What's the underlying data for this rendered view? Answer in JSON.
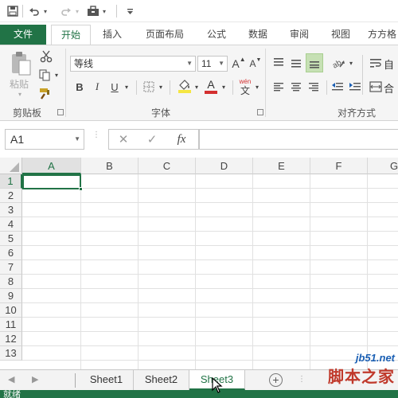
{
  "ribbon_tabs": {
    "file": "文件",
    "home": "开始",
    "insert": "插入",
    "page_layout": "页面布局",
    "formulas": "公式",
    "data": "数据",
    "review": "审阅",
    "view": "视图",
    "more": "方方格"
  },
  "home": {
    "paste_label": "粘贴",
    "font_name": "等线",
    "font_size": "11",
    "grow_font": "A",
    "shrink_font": "A",
    "bold": "B",
    "italic": "I",
    "underline": "U",
    "font_color_letter": "A",
    "phonetic_top": "wén",
    "phonetic_bottom": "文",
    "wrap_partial": "自",
    "merge_partial": "合",
    "groups": {
      "clipboard": "剪贴板",
      "font": "字体",
      "alignment": "对齐方式"
    },
    "colors": {
      "highlight": "#f5e642",
      "font_color": "#d32f2f",
      "accent": "#217346"
    }
  },
  "formula_bar": {
    "name_box": "A1",
    "cancel": "✕",
    "enter": "✓",
    "fx": "fx",
    "formula": ""
  },
  "grid": {
    "columns": [
      "A",
      "B",
      "C",
      "D",
      "E",
      "F",
      "G"
    ],
    "rows": [
      "1",
      "2",
      "3",
      "4",
      "5",
      "6",
      "7",
      "8",
      "9",
      "10",
      "11",
      "12",
      "13"
    ],
    "active_cell": "A1"
  },
  "sheets": {
    "tabs": [
      "Sheet1",
      "Sheet2",
      "Sheet3"
    ],
    "active": "Sheet3",
    "add": "+"
  },
  "status": {
    "text": "就绪"
  },
  "watermark": {
    "url": "jb51.net",
    "name": "脚本之家"
  }
}
